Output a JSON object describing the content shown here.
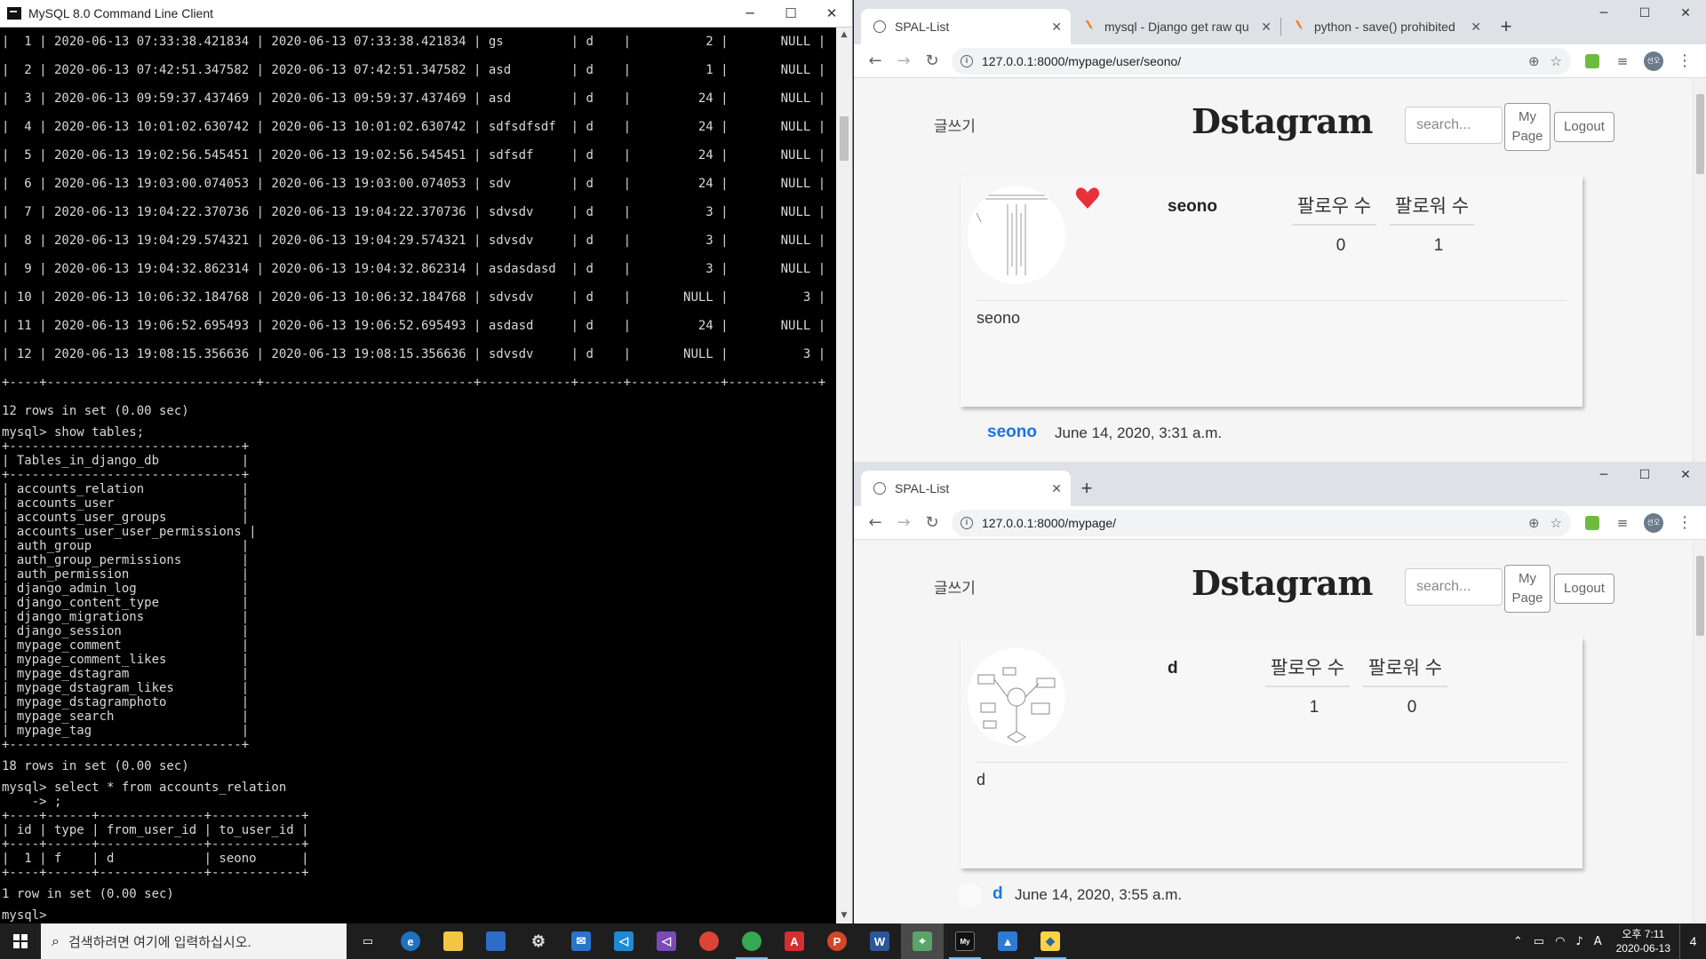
{
  "console": {
    "title": "MySQL 8.0 Command Line Client",
    "rows": [
      "|  1 | 2020-06-13 07:33:38.421834 | 2020-06-13 07:33:38.421834 | gs         | d    |          2 |       NULL |",
      "|  2 | 2020-06-13 07:42:51.347582 | 2020-06-13 07:42:51.347582 | asd        | d    |          1 |       NULL |",
      "|  3 | 2020-06-13 09:59:37.437469 | 2020-06-13 09:59:37.437469 | asd        | d    |         24 |       NULL |",
      "|  4 | 2020-06-13 10:01:02.630742 | 2020-06-13 10:01:02.630742 | sdfsdfsdf  | d    |         24 |       NULL |",
      "|  5 | 2020-06-13 19:02:56.545451 | 2020-06-13 19:02:56.545451 | sdfsdf     | d    |         24 |       NULL |",
      "|  6 | 2020-06-13 19:03:00.074053 | 2020-06-13 19:03:00.074053 | sdv        | d    |         24 |       NULL |",
      "|  7 | 2020-06-13 19:04:22.370736 | 2020-06-13 19:04:22.370736 | sdvsdv     | d    |          3 |       NULL |",
      "|  8 | 2020-06-13 19:04:29.574321 | 2020-06-13 19:04:29.574321 | sdvsdv     | d    |          3 |       NULL |",
      "|  9 | 2020-06-13 19:04:32.862314 | 2020-06-13 19:04:32.862314 | asdasdasd  | d    |          3 |       NULL |",
      "| 10 | 2020-06-13 10:06:32.184768 | 2020-06-13 10:06:32.184768 | sdvsdv     | d    |       NULL |          3 |",
      "| 11 | 2020-06-13 19:06:52.695493 | 2020-06-13 19:06:52.695493 | asdasd     | d    |         24 |       NULL |",
      "| 12 | 2020-06-13 19:08:15.356636 | 2020-06-13 19:08:15.356636 | sdvsdv     | d    |       NULL |          3 |"
    ],
    "rows_border": "+----+----------------------------+----------------------------+------------+------+------------+------------+",
    "result1": "12 rows in set (0.00 sec)",
    "cmd_show": "mysql> show tables;",
    "tables_border": "+-------------------------------+",
    "tables_header": "| Tables_in_django_db           |",
    "tables": [
      "| accounts_relation             |",
      "| accounts_user                 |",
      "| accounts_user_groups          |",
      "| accounts_user_user_permissions |",
      "| auth_group                    |",
      "| auth_group_permissions        |",
      "| auth_permission               |",
      "| django_admin_log              |",
      "| django_content_type           |",
      "| django_migrations             |",
      "| django_session                |",
      "| mypage_comment                |",
      "| mypage_comment_likes          |",
      "| mypage_dstagram               |",
      "| mypage_dstagram_likes         |",
      "| mypage_dstagramphoto          |",
      "| mypage_search                 |",
      "| mypage_tag                    |"
    ],
    "result2": "18 rows in set (0.00 sec)",
    "cmd_select": "mysql> select * from accounts_relation",
    "cmd_cont": "    -> ;",
    "rel_border": "+----+------+--------------+------------+",
    "rel_header": "| id | type | from_user_id | to_user_id |",
    "rel_row": "|  1 | f    | d            | seono      |",
    "result3": "1 row in set (0.00 sec)",
    "prompt": "mysql>"
  },
  "browser_top": {
    "tabs": [
      {
        "label": "SPAL-List",
        "icon": "globe-icon"
      },
      {
        "label": "mysql - Django get raw qu",
        "icon": "stackoverflow-icon"
      },
      {
        "label": "python - save() prohibited",
        "icon": "stackoverflow-icon"
      }
    ],
    "url": "127.0.0.1:8000/mypage/user/seono/",
    "page": {
      "write": "글쓰기",
      "brand": "Dstagram",
      "search_placeholder": "search...",
      "mypage": "My Page",
      "logout": "Logout",
      "username": "seono",
      "following_label": "팔로우 수",
      "follower_label": "팔로워 수",
      "following": "0",
      "followers": "1",
      "bio": "seono",
      "post_user": "seono",
      "post_date": "June 14, 2020, 3:31 a.m."
    }
  },
  "browser_bottom": {
    "tabs": [
      {
        "label": "SPAL-List",
        "icon": "globe-icon"
      }
    ],
    "url": "127.0.0.1:8000/mypage/",
    "page": {
      "write": "글쓰기",
      "brand": "Dstagram",
      "search_placeholder": "search...",
      "mypage": "My Page",
      "logout": "Logout",
      "username": "d",
      "following_label": "팔로우 수",
      "follower_label": "팔로워 수",
      "following": "1",
      "followers": "0",
      "bio": "d",
      "post_user": "d",
      "post_date": "June 14, 2020, 3:55 a.m."
    }
  },
  "taskbar": {
    "search_placeholder": "검색하려면 여기에 입력하십시오.",
    "time": "오후 7:11",
    "date": "2020-06-13",
    "notif_count": "4",
    "avatar_text": "선오",
    "ime": "A"
  },
  "colors": {
    "accent_link": "#1b74e4",
    "heart": "#e8303a",
    "console_bg": "#000000",
    "taskbar_bg": "#1e1e1e"
  }
}
